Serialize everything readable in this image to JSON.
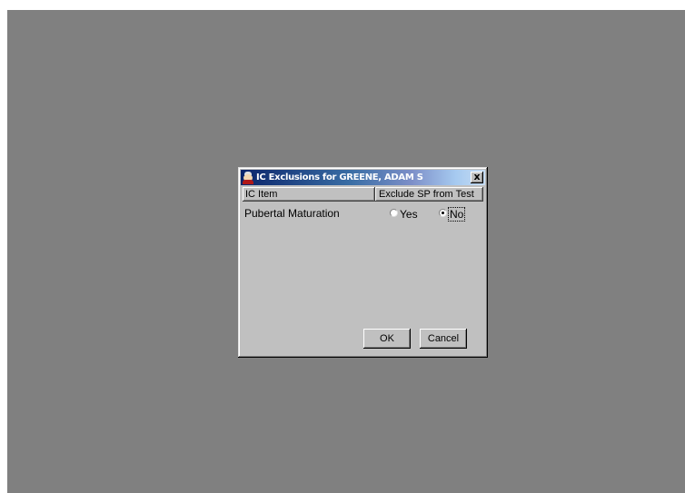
{
  "dialog": {
    "title": "IC Exclusions for GREENE, ADAM S",
    "close_label": "x"
  },
  "table": {
    "headers": [
      "IC Item",
      "Exclude SP from Test"
    ],
    "rows": [
      {
        "label": "Pubertal Maturation",
        "options": [
          "Yes",
          "No"
        ],
        "selected": "No"
      }
    ]
  },
  "buttons": {
    "ok": "OK",
    "cancel": "Cancel"
  }
}
